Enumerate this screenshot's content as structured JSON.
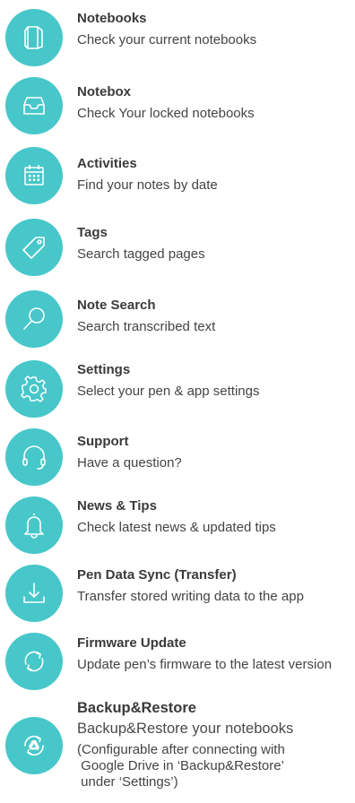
{
  "colors": {
    "accent": "#47c7c9",
    "title_text": "#3a3a3a",
    "desc_text": "#444444"
  },
  "menu": {
    "items": [
      {
        "title": "Notebooks",
        "desc": "Check your current notebooks",
        "icon": "notebooks-icon"
      },
      {
        "title": "Notebox",
        "desc": "Check Your locked notebooks",
        "icon": "notebox-icon"
      },
      {
        "title": "Activities",
        "desc": "Find your notes by date",
        "icon": "calendar-icon"
      },
      {
        "title": "Tags",
        "desc": "Search tagged pages",
        "icon": "tag-icon"
      },
      {
        "title": "Note Search",
        "desc": "Search transcribed text",
        "icon": "search-icon"
      },
      {
        "title": "Settings",
        "desc": "Select your pen & app settings",
        "icon": "gear-icon"
      },
      {
        "title": "Support",
        "desc": "Have a question?",
        "icon": "headset-icon"
      },
      {
        "title": "News & Tips",
        "desc": "Check latest news & updated tips",
        "icon": "bell-icon"
      },
      {
        "title": "Pen Data Sync (Transfer)",
        "desc": "Transfer stored writing data to the app",
        "icon": "download-icon"
      },
      {
        "title": "Firmware Update",
        "desc": "Update pen’s firmware to the latest version",
        "icon": "refresh-icon"
      },
      {
        "title": "Backup&Restore",
        "desc": "Backup&Restore your notebooks",
        "note": "(Configurable after connecting with\n Google Drive in ‘Backup&Restore’\n under ‘Settings’)",
        "icon": "google-drive-sync-icon"
      }
    ]
  }
}
